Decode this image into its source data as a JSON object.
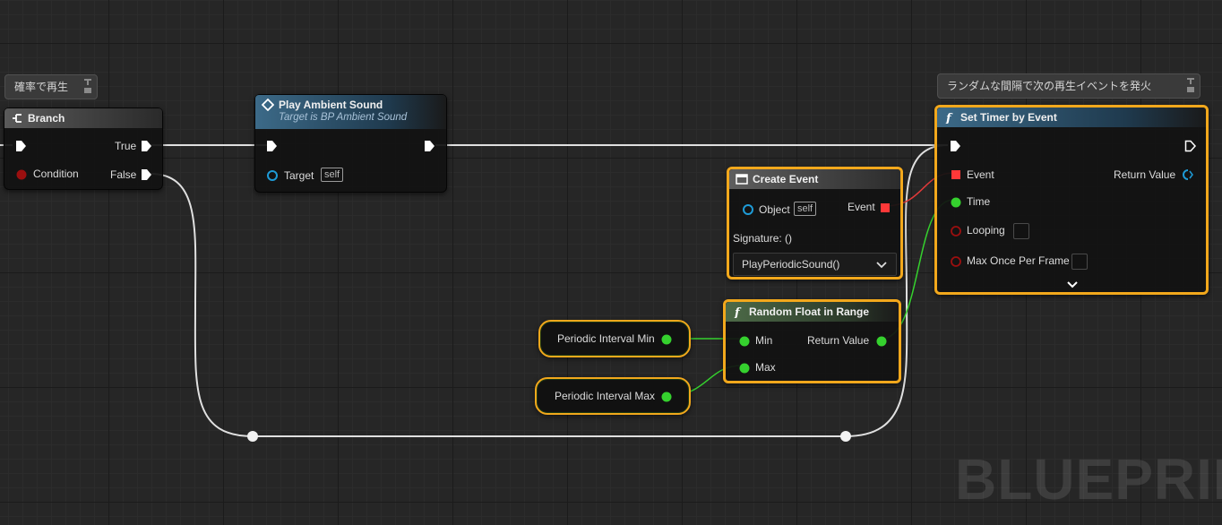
{
  "comments": {
    "branch_comment": "確率で再生",
    "timer_comment": "ランダムな間隔で次の再生イベントを発火"
  },
  "branch": {
    "title": "Branch",
    "true_label": "True",
    "condition_label": "Condition",
    "false_label": "False"
  },
  "play_ambient": {
    "title": "Play Ambient Sound",
    "subtitle": "Target is BP Ambient Sound",
    "target_label": "Target",
    "target_value": "self"
  },
  "create_event": {
    "title": "Create Event",
    "object_label": "Object",
    "object_value": "self",
    "event_label": "Event",
    "signature": "Signature: ()",
    "function_selected": "PlayPeriodicSound()"
  },
  "random_float": {
    "title": "Random Float in Range",
    "min_label": "Min",
    "max_label": "Max",
    "return_label": "Return Value"
  },
  "variables": {
    "min": "Periodic Interval Min",
    "max": "Periodic Interval Max"
  },
  "set_timer": {
    "title": "Set Timer by Event",
    "event_label": "Event",
    "return_label": "Return Value",
    "time_label": "Time",
    "looping_label": "Looping",
    "max_once_label": "Max Once Per Frame"
  },
  "watermark": "BLUEPRINT",
  "colors": {
    "selection": "#f2a81c",
    "exec_wire": "#e0e0e0",
    "float_pin": "#35d12e",
    "bool_pin": "#9b0f0f",
    "object_pin": "#1e9bd7",
    "delegate_pin": "#ff3838"
  }
}
